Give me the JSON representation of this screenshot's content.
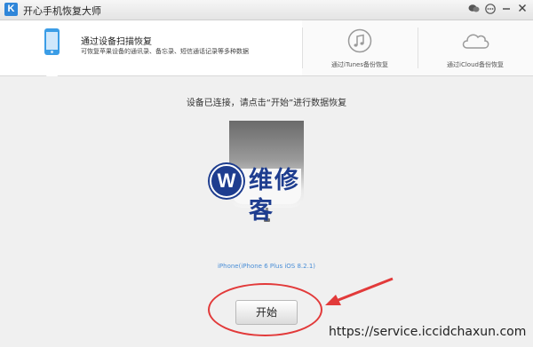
{
  "window": {
    "logo_letter": "K",
    "title": "开心手机恢复大师"
  },
  "tabs": {
    "device_scan": {
      "title": "通过设备扫描恢复",
      "description": "可恢复苹果设备的通讯录、备忘录、短信通话记录等多种数据"
    },
    "itunes": {
      "label": "通过iTunes备份恢复"
    },
    "icloud": {
      "label": "通过iCloud备份恢复"
    }
  },
  "main": {
    "instruction": "设备已连接，请点击“开始”进行数据恢复",
    "device_name": "iPhone(iPhone 6 Plus iOS 8.2.1)",
    "start_button": "开始"
  },
  "watermark": {
    "logo_letter": "W",
    "text": "维修客",
    "url": "https://service.iccidchaxun.com"
  },
  "colors": {
    "accent": "#3b9de6",
    "annotation": "#e23a3a",
    "watermark": "#1e3d8f"
  }
}
